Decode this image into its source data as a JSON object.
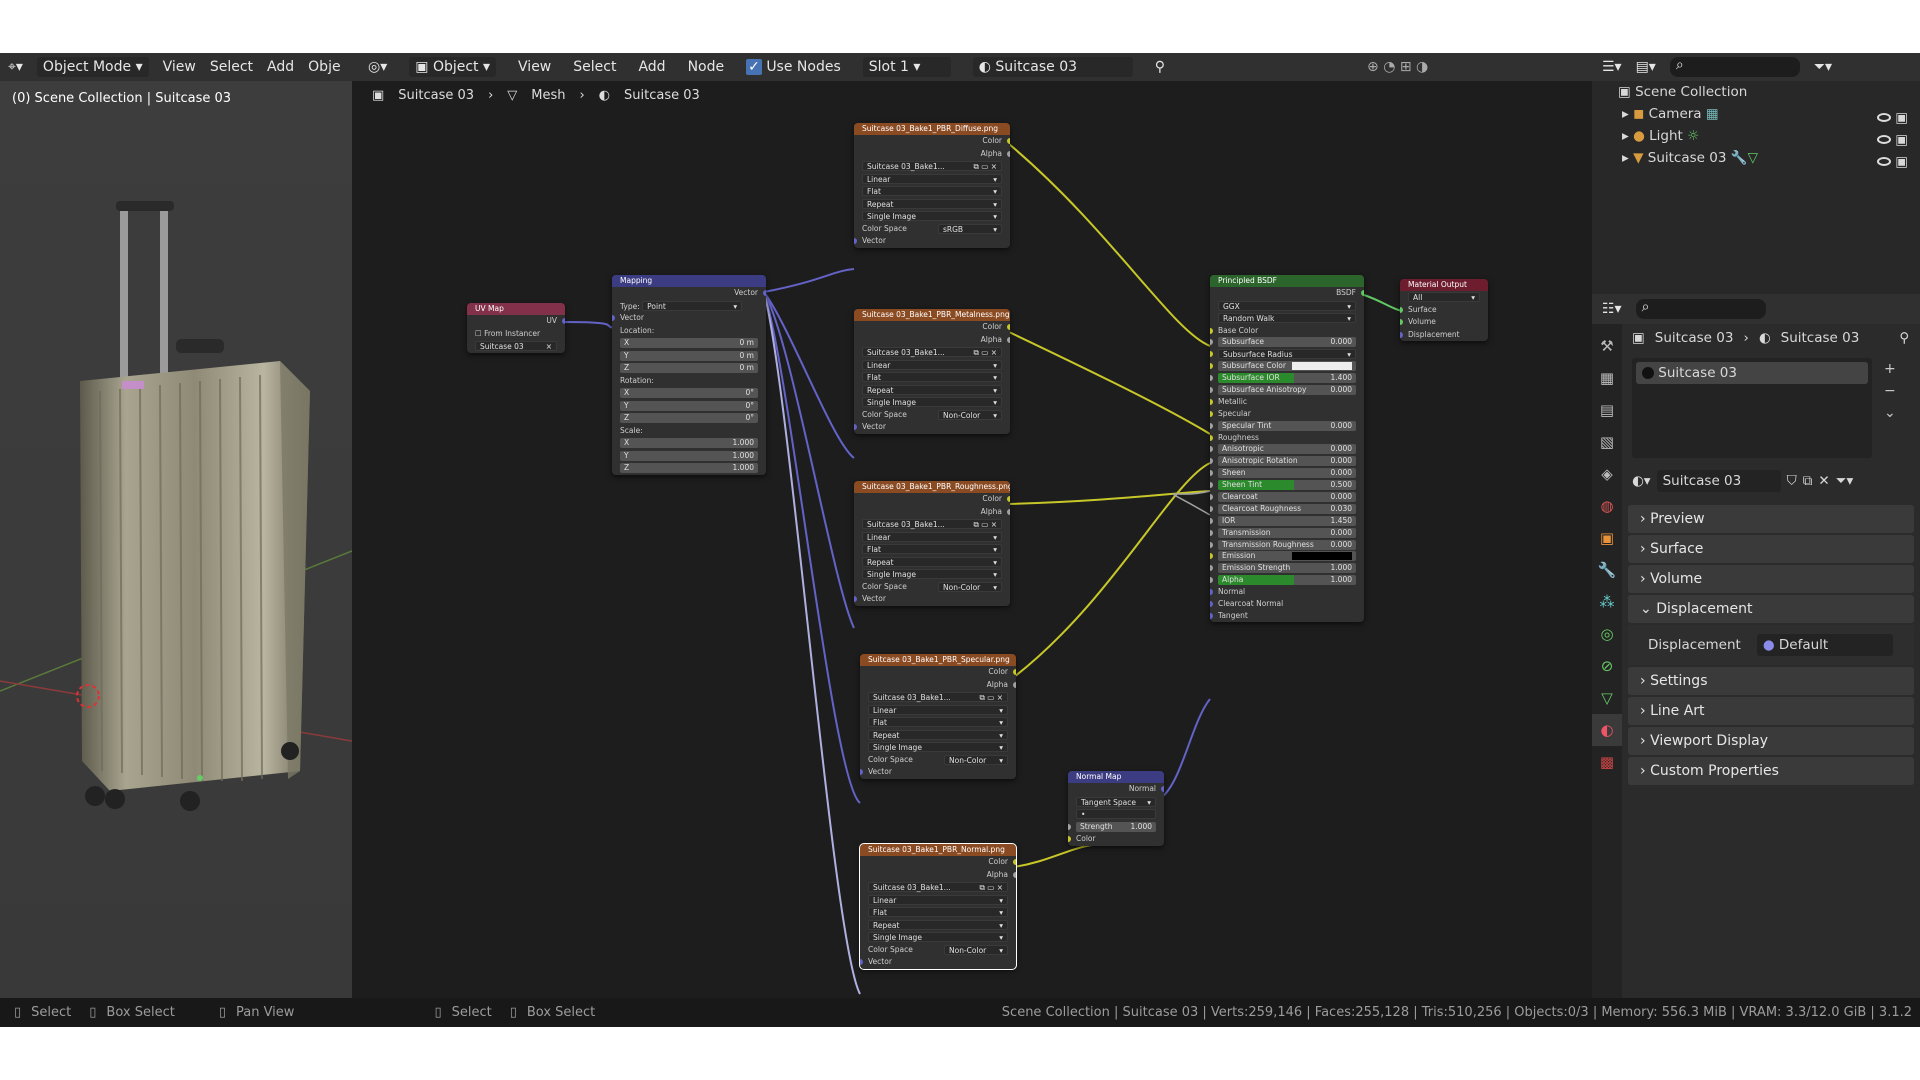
{
  "viewport": {
    "editor_icon": "view3d-icon",
    "mode": "Object Mode",
    "menus": [
      "View",
      "Select",
      "Add",
      "Obje"
    ],
    "overlay_text": "(0) Scene Collection | Suitcase 03"
  },
  "node_editor": {
    "editor_icon": "node-editor-icon",
    "object": "Object",
    "menus": [
      "View",
      "Select",
      "Add",
      "Node"
    ],
    "use_nodes": "Use Nodes",
    "slot": "Slot 1",
    "material": "Suitcase 03",
    "breadcrumb": [
      "Suitcase 03",
      "Mesh",
      "Suitcase 03"
    ]
  },
  "nodes": {
    "uvmap": {
      "title": "UV Map",
      "out": "UV",
      "from_instancer": "From Instancer",
      "uv": "Suitcase 03"
    },
    "mapping": {
      "title": "Mapping",
      "out": "Vector",
      "type_label": "Type:",
      "type": "Point",
      "vector": "Vector",
      "location": "Location:",
      "rotation": "Rotation:",
      "scale": "Scale:",
      "loc": [
        [
          "X",
          "0 m"
        ],
        [
          "Y",
          "0 m"
        ],
        [
          "Z",
          "0 m"
        ]
      ],
      "rot": [
        [
          "X",
          "0°"
        ],
        [
          "Y",
          "0°"
        ],
        [
          "Z",
          "0°"
        ]
      ],
      "scl": [
        [
          "X",
          "1.000"
        ],
        [
          "Y",
          "1.000"
        ],
        [
          "Z",
          "1.000"
        ]
      ]
    },
    "textures": [
      {
        "title": "Suitcase 03_Bake1_PBR_Diffuse.png",
        "img": "Suitcase 03_Bake1...",
        "interp": "Linear",
        "proj": "Flat",
        "ext": "Repeat",
        "src": "Single Image",
        "cs_label": "Color Space",
        "cs": "sRGB"
      },
      {
        "title": "Suitcase 03_Bake1_PBR_Metalness.png",
        "img": "Suitcase 03_Bake1...",
        "interp": "Linear",
        "proj": "Flat",
        "ext": "Repeat",
        "src": "Single Image",
        "cs_label": "Color Space",
        "cs": "Non-Color"
      },
      {
        "title": "Suitcase 03_Bake1_PBR_Roughness.png",
        "img": "Suitcase 03_Bake1...",
        "interp": "Linear",
        "proj": "Flat",
        "ext": "Repeat",
        "src": "Single Image",
        "cs_label": "Color Space",
        "cs": "Non-Color"
      },
      {
        "title": "Suitcase 03_Bake1_PBR_Specular.png",
        "img": "Suitcase 03_Bake1...",
        "interp": "Linear",
        "proj": "Flat",
        "ext": "Repeat",
        "src": "Single Image",
        "cs_label": "Color Space",
        "cs": "Non-Color"
      },
      {
        "title": "Suitcase 03_Bake1_PBR_Normal.png",
        "img": "Suitcase 03_Bake1...",
        "interp": "Linear",
        "proj": "Flat",
        "ext": "Repeat",
        "src": "Single Image",
        "cs_label": "Color Space",
        "cs": "Non-Color"
      }
    ],
    "tex_sockets": {
      "color": "Color",
      "alpha": "Alpha",
      "vector": "Vector"
    },
    "normalmap": {
      "title": "Normal Map",
      "out": "Normal",
      "space": "Tangent Space",
      "strength": "Strength",
      "strength_val": "1.000",
      "color": "Color"
    },
    "bsdf": {
      "title": "Principled BSDF",
      "out": "BSDF",
      "dist": "GGX",
      "sss": "Random Walk",
      "rows": [
        [
          "Base Color",
          ""
        ],
        [
          "Subsurface",
          "0.000"
        ],
        [
          "Subsurface Radius",
          ""
        ],
        [
          "Subsurface Color",
          ""
        ],
        [
          "Subsurface IOR",
          "1.400"
        ],
        [
          "Subsurface Anisotropy",
          "0.000"
        ],
        [
          "Metallic",
          ""
        ],
        [
          "Specular",
          ""
        ],
        [
          "Specular Tint",
          "0.000"
        ],
        [
          "Roughness",
          ""
        ],
        [
          "Anisotropic",
          "0.000"
        ],
        [
          "Anisotropic Rotation",
          "0.000"
        ],
        [
          "Sheen",
          "0.000"
        ],
        [
          "Sheen Tint",
          "0.500"
        ],
        [
          "Clearcoat",
          "0.000"
        ],
        [
          "Clearcoat Roughness",
          "0.030"
        ],
        [
          "IOR",
          "1.450"
        ],
        [
          "Transmission",
          "0.000"
        ],
        [
          "Transmission Roughness",
          "0.000"
        ],
        [
          "Emission",
          ""
        ],
        [
          "Emission Strength",
          "1.000"
        ],
        [
          "Alpha",
          "1.000"
        ],
        [
          "Normal",
          ""
        ],
        [
          "Clearcoat Normal",
          ""
        ],
        [
          "Tangent",
          ""
        ]
      ]
    },
    "output": {
      "title": "Material Output",
      "target": "All",
      "surface": "Surface",
      "volume": "Volume",
      "displacement": "Displacement"
    }
  },
  "outliner": {
    "root": "Scene Collection",
    "items": [
      {
        "name": "Camera"
      },
      {
        "name": "Light"
      },
      {
        "name": "Suitcase 03"
      }
    ]
  },
  "properties": {
    "breadcrumb": [
      "Suitcase 03",
      "Suitcase 03"
    ],
    "slot": "Suitcase 03",
    "material": "Suitcase 03",
    "panels": [
      "Preview",
      "Surface",
      "Volume",
      "Displacement",
      "Settings",
      "Line Art",
      "Viewport Display",
      "Custom Properties"
    ],
    "displacement_label": "Displacement",
    "displacement_value": "Default"
  },
  "status": {
    "left": [
      "Select",
      "Box Select",
      "Pan View",
      "Select",
      "Box Select"
    ],
    "right": "Scene Collection | Suitcase 03 | Verts:259,146 | Faces:255,128 | Tris:510,256 | Objects:0/3 | Memory: 556.3 MiB | VRAM: 3.3/12.0 GiB | 3.1.2"
  },
  "colors": {
    "texture_header": "#8a4a22",
    "vector_header": "#3c3c83",
    "shader_header": "#2b652b",
    "output_header": "#6e1d2e",
    "uvmap_header": "#83314a"
  }
}
